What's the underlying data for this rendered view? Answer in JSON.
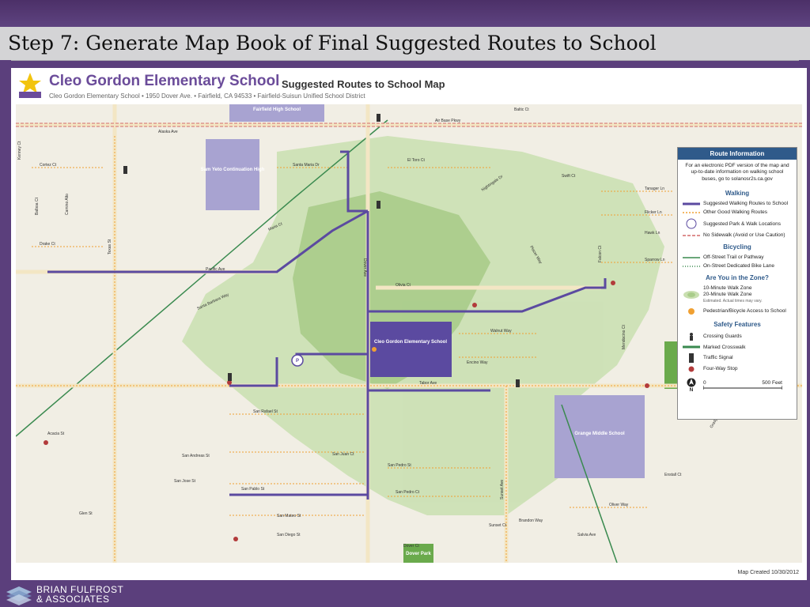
{
  "slide": {
    "title": "Step 7: Generate Map Book of Final Suggested Routes to School"
  },
  "map_header": {
    "school_name": "Cleo Gordon Elementary School",
    "map_title": "Suggested Routes to School Map",
    "subtitle": "Cleo Gordon Elementary School • 1950 Dover Ave. • Fairfield, CA 94533 • Fairfield-Suisun Unified School District"
  },
  "credit": "Map Created 10/30/2012",
  "legend": {
    "header": "Route Information",
    "note": "For an electronic PDF version of the map and up-to-date information on walking school buses, go to solanosr2s.ca.gov",
    "walking_title": "Walking",
    "walking_items": [
      "Suggested Walking Routes to School",
      "Other Good Walking Routes",
      "Suggested Park & Walk Locations",
      "No Sidewalk (Avoid or Use Caution)"
    ],
    "bicycling_title": "Bicycling",
    "bicycling_items": [
      "Off-Street Trail or Pathway",
      "On-Street Dedicated Bike Lane"
    ],
    "zone_title": "Are You in the Zone?",
    "zone_items": [
      "10-Minute Walk Zone",
      "20-Minute Walk Zone",
      "Estimated. Actual times may vary."
    ],
    "access_item": "Pedestrian/Bicycle Access to School",
    "safety_title": "Safety Features",
    "safety_items": [
      "Crossing Guards",
      "Marked Crosswalk",
      "Traffic Signal",
      "Four-Way Stop"
    ],
    "scale_zero": "0",
    "scale_label": "500 Feet",
    "north": "N"
  },
  "buildings": {
    "fairfield_hs": "Fairfield High School",
    "sam_yeto": "Sam Yeto Continuation High",
    "cleo_gordon": "Cleo Gordon Elementary School",
    "grange": "Grange Middle School",
    "dover_park": "Dover Park"
  },
  "streets": {
    "air_base": "Air Base Pkwy",
    "dover": "Dover Ave",
    "texas": "Texas St",
    "tabor": "Tabor Ave",
    "sunset": "Sunset Ave",
    "pacific": "Pacific Ave",
    "alaska": "Alaska Ave",
    "santa_barbara": "Santa Barbara Way",
    "el_toro": "El Toro Ct",
    "walnut": "Walnut Way",
    "san_rafael": "San Rafael St",
    "san_andreas": "San Andreas St",
    "san_jose": "San Jose St",
    "san_pablo": "San Pablo St",
    "san_mateo": "San Mateo St",
    "san_juan": "San Juan Ct",
    "san_pedro": "San Pedro St",
    "san_pedro_ct": "San Pedro Ct",
    "glen_st": "Glen St",
    "acacia": "Acacia St",
    "cortez": "Cortez Ct",
    "drake": "Drake Ct",
    "santa_maria": "Santa Maria Dr",
    "san_diego": "San Diego St",
    "sunset_ct": "Sunset Ct",
    "brandon": "Brandon Way",
    "dover_ct": "Dover Ct",
    "salvia": "Salvia Ave",
    "oliver": "Oliver Way",
    "enstall": "Enstall Ct",
    "grady": "Grady Ln",
    "sparrow": "Sparrow Ln",
    "falcon": "Falcon Ct",
    "flicker": "Flicker Ln",
    "hawk": "Hawk Ln",
    "tanager": "Tanager Ln",
    "swift": "Swift Ct",
    "balboa": "Balboa Ct",
    "camino": "Camino Alto",
    "kenney": "Kenney Ct",
    "baltic": "Baltic Ct",
    "olivia": "Olivia Ct",
    "nightingale": "Nightingale Dr",
    "maria": "Maria Ct",
    "encino": "Encino Way",
    "mendocino": "Mendocino Ct",
    "placer": "Placer Way"
  },
  "colors": {
    "route": "#5b4aa0",
    "street": "#f3e6c4",
    "street_dot": "#f0a032",
    "zone": "#c9dfb0",
    "zone_dark": "#a9cc8a",
    "background": "#f1eee4",
    "school": "#5b4aa0",
    "other_school": "#a8a3d1",
    "park": "#6aaa4c",
    "title_purple": "#6b4c9a"
  },
  "footer": {
    "company_line1": "BRIAN FULFROST",
    "company_line2": "& ASSOCIATES"
  }
}
